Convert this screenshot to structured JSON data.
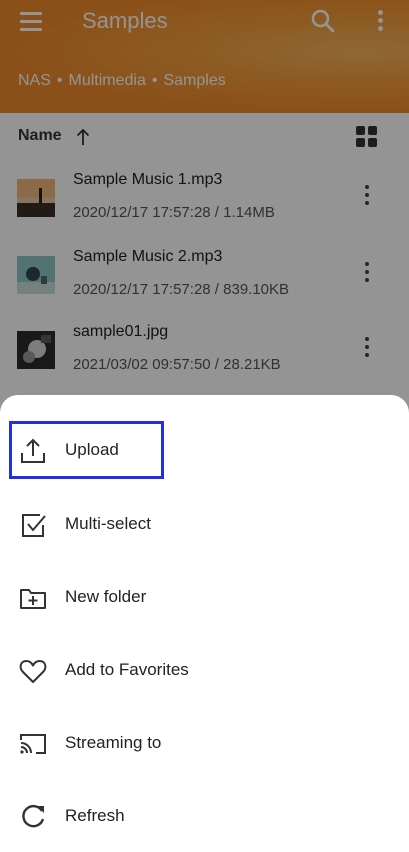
{
  "header": {
    "title": "Samples",
    "menu_icon": "hamburger-menu-icon",
    "search_icon": "search-icon",
    "more_icon": "more-vertical-icon"
  },
  "breadcrumb": [
    "NAS",
    "Multimedia",
    "Samples"
  ],
  "breadcrumb_separator": "•",
  "sort": {
    "label": "Name",
    "direction_icon": "arrow-up-icon",
    "view_icon": "grid-view-icon"
  },
  "files": [
    {
      "name": "Sample Music 1.mp3",
      "meta": "2020/12/17 17:57:28 / 1.14MB"
    },
    {
      "name": "Sample Music 2.mp3",
      "meta": "2020/12/17 17:57:28 / 839.10KB"
    },
    {
      "name": "sample01.jpg",
      "meta": "2021/03/02 09:57:50 / 28.21KB"
    }
  ],
  "sheet": {
    "items": [
      {
        "label": "Upload",
        "icon": "upload-icon"
      },
      {
        "label": "Multi-select",
        "icon": "checkbox-icon"
      },
      {
        "label": "New folder",
        "icon": "new-folder-icon"
      },
      {
        "label": "Add to Favorites",
        "icon": "heart-icon"
      },
      {
        "label": "Streaming to",
        "icon": "cast-icon"
      },
      {
        "label": "Refresh",
        "icon": "refresh-icon"
      }
    ]
  },
  "colors": {
    "accent": "#ef8a2c",
    "highlight": "#2330e0"
  }
}
